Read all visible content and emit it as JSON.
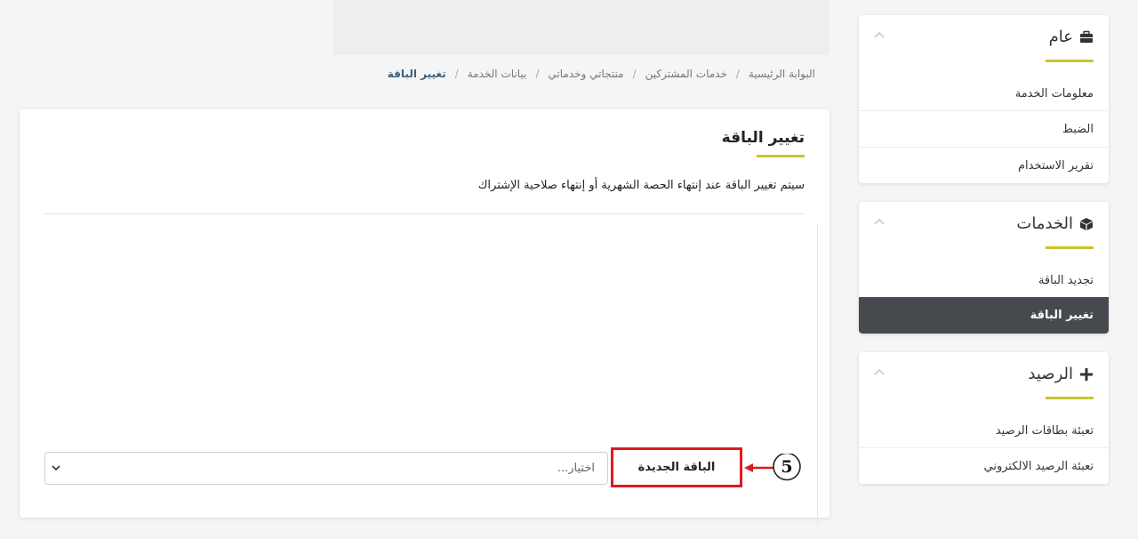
{
  "breadcrumb": [
    "البوابة الرئيسية",
    "خدمات المشتركين",
    "منتجاتي وخدماتي",
    "بيانات الخدمة",
    "تغيير الباقة"
  ],
  "main": {
    "title": "تغيير الباقة",
    "description": "سيتم تغيير الباقة عند إنتهاء الحصة الشهرية أو إنتهاء صلاحية الإشتراك",
    "new_package_label": "الباقة الجديدة",
    "select_placeholder": "اختيار...",
    "step_number": "5"
  },
  "sidebar": {
    "general": {
      "title": "عام",
      "icon": "briefcase-icon",
      "items": [
        "معلومات الخدمة",
        "الضبط",
        "تقرير الاستخدام"
      ]
    },
    "services": {
      "title": "الخدمات",
      "icon": "box-icon",
      "items": [
        "تجديد الباقة",
        "تغيير الباقة"
      ],
      "active_item": "تغيير الباقة"
    },
    "balance": {
      "title": "الرصيد",
      "icon": "plus-icon",
      "items": [
        "تعبئة بطاقات الرصيد",
        "تعبئة الرصيد الالكتروني"
      ]
    }
  },
  "colors": {
    "accent": "#c9c42f",
    "active_bg": "#464a4f",
    "highlight_red": "#e0191f",
    "breadcrumb_active": "#3b5f7c"
  }
}
